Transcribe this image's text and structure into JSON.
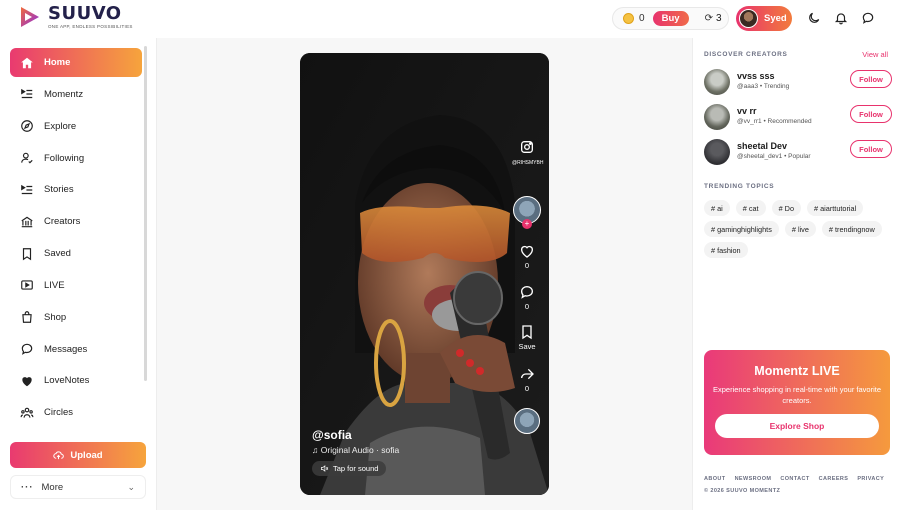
{
  "brand": {
    "name": "SUUVO",
    "tagline": "ONE APP, ENDLESS POSSIBILITIES"
  },
  "topbar": {
    "coins": "0",
    "buy_label": "Buy",
    "spins": "3",
    "user_name": "Syed",
    "icons": [
      "moon-icon",
      "bell-icon",
      "chat-bubble-icon"
    ]
  },
  "sidebar": {
    "items": [
      {
        "label": "Home",
        "icon": "home-icon",
        "active": true
      },
      {
        "label": "Momentz",
        "icon": "list-play-icon"
      },
      {
        "label": "Explore",
        "icon": "compass-icon"
      },
      {
        "label": "Following",
        "icon": "user-check-icon"
      },
      {
        "label": "Stories",
        "icon": "list-play-icon"
      },
      {
        "label": "Creators",
        "icon": "bank-icon"
      },
      {
        "label": "Saved",
        "icon": "bookmark-icon"
      },
      {
        "label": "LIVE",
        "icon": "live-video-icon"
      },
      {
        "label": "Shop",
        "icon": "shopping-bag-icon"
      },
      {
        "label": "Messages",
        "icon": "chat-bubble-icon"
      },
      {
        "label": "LoveNotes",
        "icon": "heart-icon"
      },
      {
        "label": "Circles",
        "icon": "users-icon"
      }
    ],
    "upload_label": "Upload",
    "more_label": "More"
  },
  "video": {
    "watermark": "@RIHSMYBH",
    "likes": "0",
    "comments": "0",
    "save_label": "Save",
    "shares": "0",
    "username": "@sofia",
    "audio": "Original Audio · sofia",
    "sound_label": "Tap for sound"
  },
  "right": {
    "discover_title": "DISCOVER CREATORS",
    "view_all": "View all",
    "creators": [
      {
        "name": "vvss sss",
        "sub": "@aaa3 • Trending",
        "follow": "Follow"
      },
      {
        "name": "vv rr",
        "sub": "@vv_rr1 • Recommended",
        "follow": "Follow"
      },
      {
        "name": "sheetal Dev",
        "sub": "@sheetal_dev1 • Popular",
        "follow": "Follow"
      }
    ],
    "topics_title": "TRENDING TOPICS",
    "topics": [
      "# ai",
      "# cat",
      "# Do",
      "# aiarttutorial",
      "# gaminghighlights",
      "# live",
      "# trendingnow",
      "# fashion"
    ],
    "live": {
      "title": "Momentz LIVE",
      "description": "Experience shopping in real-time with your favorite creators.",
      "button": "Explore Shop"
    },
    "footer_links": [
      "ABOUT",
      "NEWSROOM",
      "CONTACT",
      "CAREERS",
      "PRIVACY"
    ],
    "copyright": "© 2026 SUUVO MOMENTZ"
  },
  "colors": {
    "accent_start": "#e8336d",
    "accent_end": "#f6a43c"
  }
}
